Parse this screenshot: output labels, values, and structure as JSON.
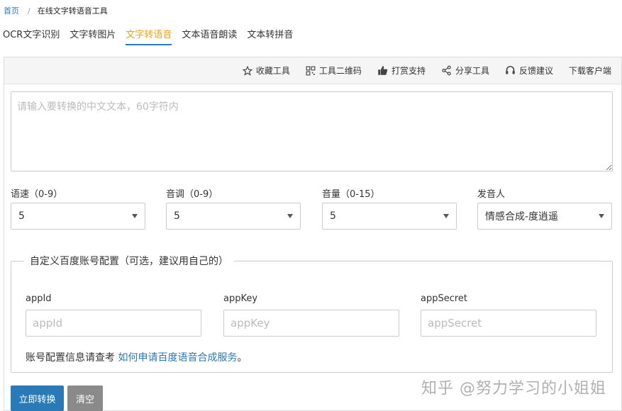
{
  "breadcrumb": {
    "home": "首页",
    "separator": "/",
    "current": "在线文字转语音工具"
  },
  "tabs": [
    {
      "label": "OCR文字识别",
      "active": false
    },
    {
      "label": "文字转图片",
      "active": false
    },
    {
      "label": "文字转语音",
      "active": true
    },
    {
      "label": "文本语音朗读",
      "active": false
    },
    {
      "label": "文本转拼音",
      "active": false
    }
  ],
  "toolbar": {
    "favorite": {
      "label": "收藏工具",
      "icon": "star-icon"
    },
    "qrcode": {
      "label": "工具二维码",
      "icon": "qrcode-icon"
    },
    "reward": {
      "label": "打赏支持",
      "icon": "thumbs-up-icon"
    },
    "share": {
      "label": "分享工具",
      "icon": "share-icon"
    },
    "feedback": {
      "label": "反馈建议",
      "icon": "headset-icon"
    },
    "download": {
      "label": "下载客户端"
    }
  },
  "input": {
    "placeholder": "请输入要转换的中文文本，60字符内",
    "value": ""
  },
  "selects": {
    "speed": {
      "label": "语速（0-9）",
      "value": "5"
    },
    "pitch": {
      "label": "音调（0-9）",
      "value": "5"
    },
    "volume": {
      "label": "音量（0-15）",
      "value": "5"
    },
    "speaker": {
      "label": "发音人",
      "value": "情感合成-度逍遥"
    }
  },
  "config": {
    "legend": "自定义百度账号配置（可选，建议用自己的）",
    "appid": {
      "label": "appId",
      "placeholder": "appId"
    },
    "appkey": {
      "label": "appKey",
      "placeholder": "appKey"
    },
    "appsecret": {
      "label": "appSecret",
      "placeholder": "appSecret"
    },
    "note_prefix": "账号配置信息请查考",
    "note_link": "如何申请百度语音合成服务",
    "note_suffix": "。"
  },
  "buttons": {
    "convert": "立即转换",
    "clear": "清空"
  },
  "watermark": "知乎 @努力学习的小姐姐",
  "colors": {
    "accent": "#2a7ab8",
    "active_tab": "#e8a21a",
    "clear_button": "#8a8a8a"
  }
}
